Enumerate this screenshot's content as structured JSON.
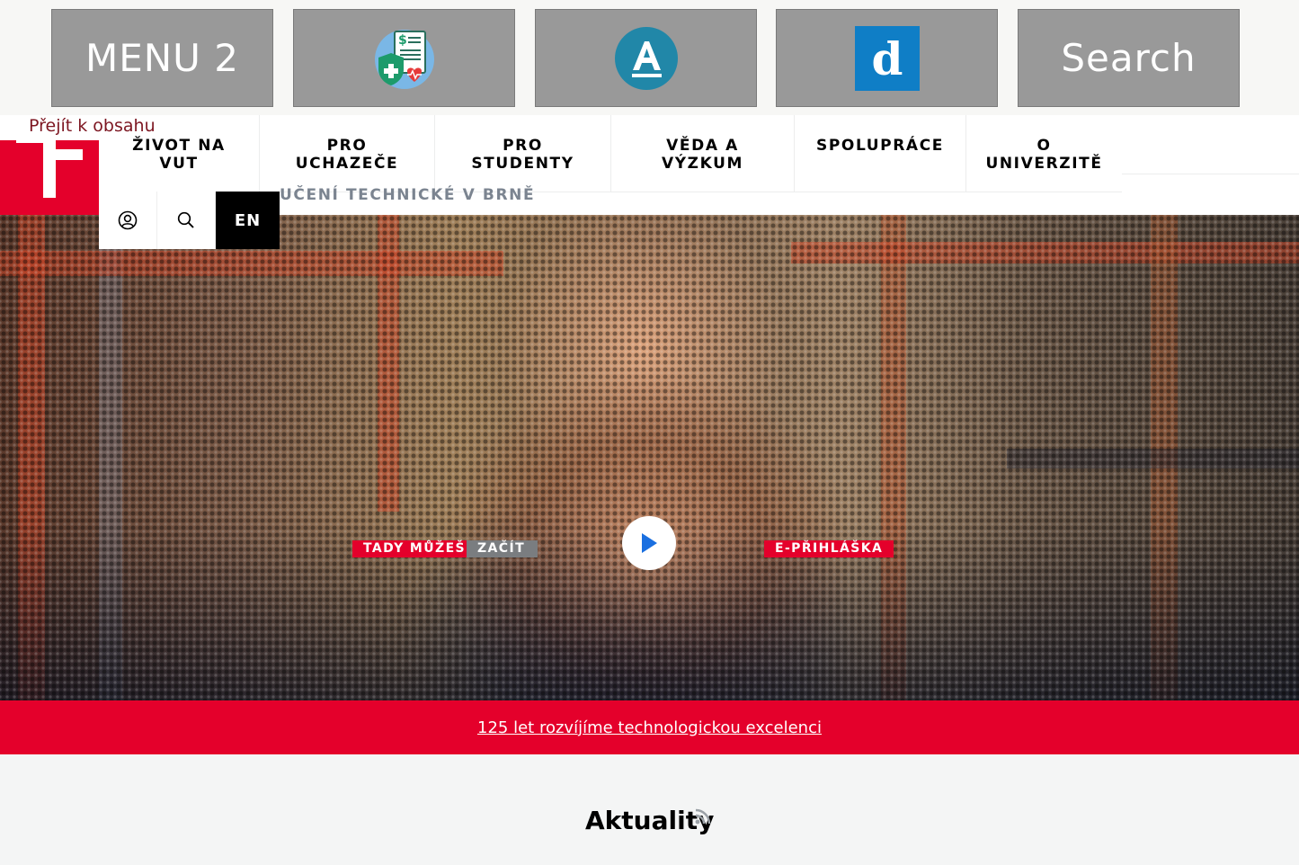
{
  "tiles": {
    "menu_label": "MENU 2",
    "search_label": "Search",
    "icons": [
      "health-insurance-icon",
      "letter-a-icon",
      "letter-d-icon"
    ]
  },
  "header": {
    "skip_link": "Přejít k obsahu",
    "nav": [
      {
        "label": "Život na\nVUT"
      },
      {
        "label": "Pro\nuchazeče"
      },
      {
        "label": "Pro\nstudenty"
      },
      {
        "label": "Věda a\nvýzkum"
      },
      {
        "label": "Spolupráce"
      },
      {
        "label": "O\nuniverzitě"
      }
    ],
    "subtitle": "UČENÍ TECHNICKÉ V BRNĚ",
    "language": "EN"
  },
  "hero": {
    "tag_1": "TADY MŮŽEŠ",
    "tag_2": "ZAČÍT",
    "application": "E-PŘIHLÁŠKA"
  },
  "banner": {
    "link": "125 let rozvíjíme technologickou excelenci"
  },
  "news": {
    "title": "Aktuality"
  },
  "colors": {
    "brand_red": "#e4002b",
    "tile_gray": "#999999",
    "skip_link": "#7d1621"
  }
}
